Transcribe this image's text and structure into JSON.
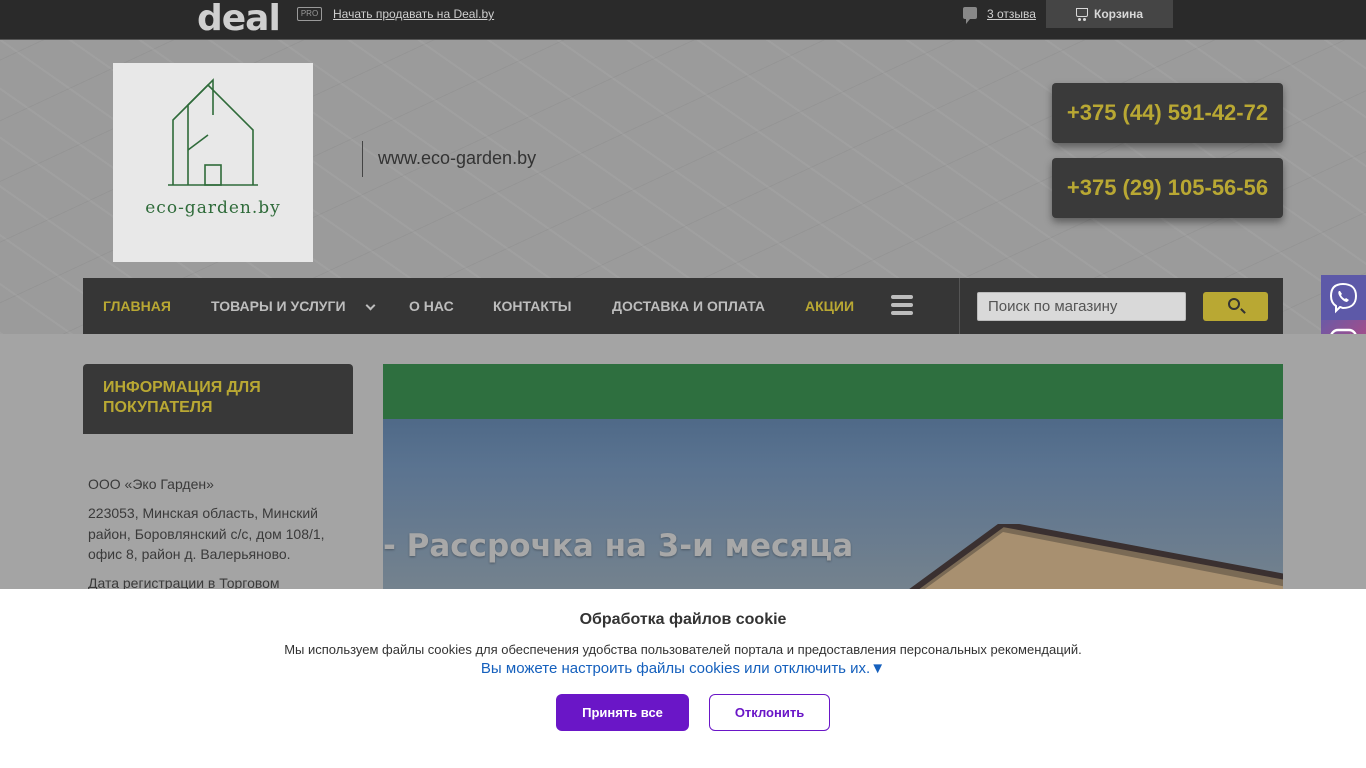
{
  "topbar": {
    "logo": "deal",
    "pro": "PRO",
    "sell_link": "Начать продавать на Deal.by",
    "reviews": "3 отзыва",
    "cart": "Корзина"
  },
  "header": {
    "logo_text": "eco-garden.by",
    "site_url": "www.eco-garden.by",
    "phones": [
      "+375 (44) 591-42-72",
      "+375 (29) 105-56-56"
    ]
  },
  "nav": {
    "items": [
      {
        "label": "Главная",
        "active": true
      },
      {
        "label": "Товары и услуги",
        "active": false
      },
      {
        "label": "О нас",
        "active": false
      },
      {
        "label": "Контакты",
        "active": false
      },
      {
        "label": "Доставка и оплата",
        "active": false
      },
      {
        "label": "Акции",
        "active": true
      }
    ],
    "search_placeholder": "Поиск по магазину"
  },
  "sidebar": {
    "title": "Информация для покупателя",
    "company": "ООО «Эко Гарден»",
    "address": "223053, Минская область, Минский район, Боровлянский с/с, дом 108/1, офис 8, район д. Валерьяново.",
    "registration": "Дата регистрации в Торговом"
  },
  "banner": {
    "text": "- Рассрочка на 3-и месяца"
  },
  "cookie": {
    "title": "Обработка файлов cookie",
    "text": "Мы используем файлы cookies для обеспечения удобства пользователей портала и предоставления персональных рекомендаций.",
    "link": "Вы можете настроить файлы cookies или отключить их.▼",
    "accept": "Принять все",
    "decline": "Отклонить"
  },
  "colors": {
    "accent": "#b9a833",
    "nav_bg": "#363636",
    "cookie_primary": "#6a16c7"
  }
}
